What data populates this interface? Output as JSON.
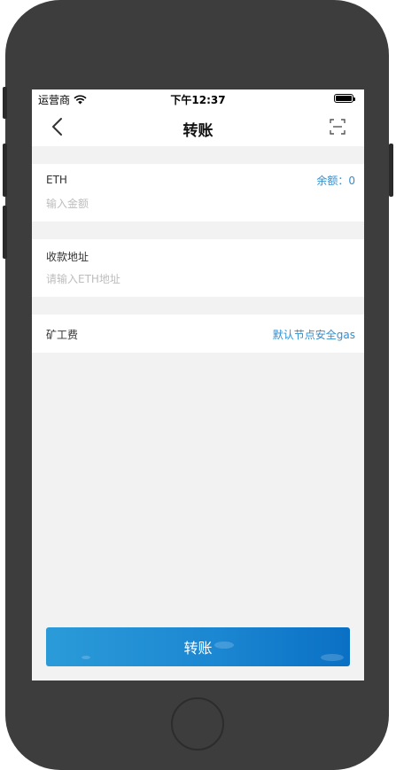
{
  "status_bar": {
    "carrier": "运营商",
    "time": "下午12:37",
    "wifi_icon": "wifi-icon",
    "battery_icon": "battery-icon"
  },
  "nav": {
    "title": "转账",
    "back_icon": "back-chevron-icon",
    "scan_icon": "scan-icon"
  },
  "amount": {
    "token": "ETH",
    "balance_label": "余额：0",
    "placeholder": "输入金额",
    "value": ""
  },
  "address": {
    "label": "收款地址",
    "placeholder": "请输入ETH地址",
    "value": ""
  },
  "fee": {
    "label": "矿工费",
    "link": "默认节点安全gas"
  },
  "submit": {
    "label": "转账"
  },
  "colors": {
    "accent": "#2e8fd3",
    "button_start": "#2b9bd8",
    "button_end": "#0a70c4",
    "page_bg": "#f2f2f2"
  }
}
